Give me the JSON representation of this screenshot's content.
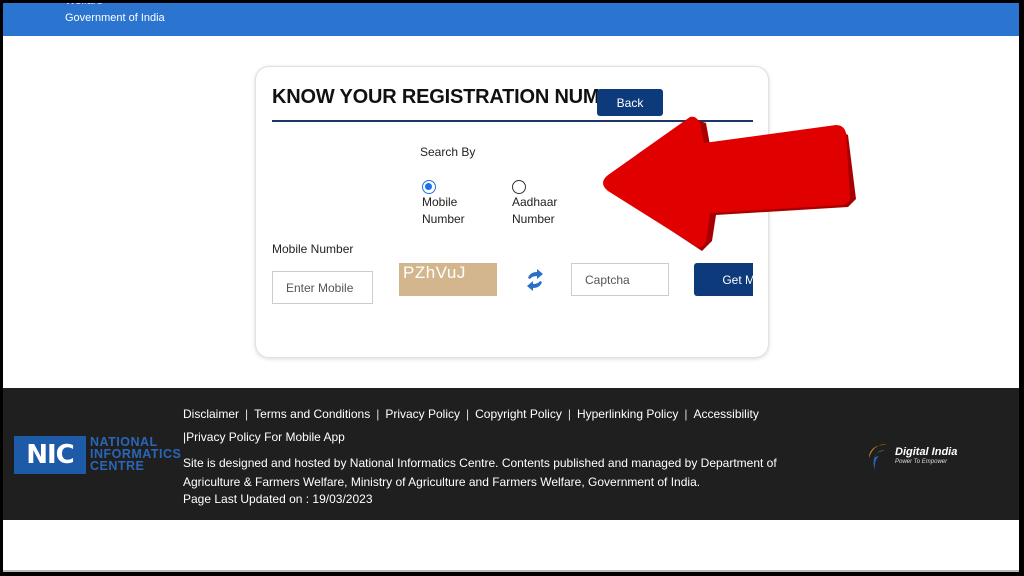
{
  "header": {
    "org_line1": "Welfare",
    "org_line2": "Government of India"
  },
  "form": {
    "title": "KNOW YOUR REGISTRATION NUMBER",
    "back_label": "Back",
    "search_by_label": "Search By",
    "options": [
      {
        "label": "Mobile Number",
        "selected": true
      },
      {
        "label": "Aadhaar Number",
        "selected": false
      }
    ],
    "mobile_label": "Mobile Number",
    "mobile_placeholder": "Enter Mobile",
    "captcha_text": "PZhVuJ",
    "captcha_placeholder": "Captcha",
    "get_button_label": "Get M"
  },
  "annotation": {
    "arrow_color": "#e00000",
    "arrow_direction": "left"
  },
  "footer": {
    "links": [
      "Disclaimer",
      "Terms and Conditions",
      "Privacy Policy",
      "Copyright Policy",
      "Hyperlinking Policy",
      "Accessibility"
    ],
    "links_line2": "Privacy Policy For Mobile App",
    "hosted_text": "Site is designed and hosted by National Informatics Centre. Contents published and managed by Department of Agriculture & Farmers Welfare, Ministry of Agriculture and Farmers Welfare, Government of India.",
    "last_updated": "Page Last Updated on : 19/03/2023",
    "nic_logo": {
      "abbr": "NIC",
      "line1": "NATIONAL",
      "line2": "INFORMATICS",
      "line3": "CENTRE"
    },
    "digital_india": {
      "title": "Digital India",
      "tagline": "Power To Empower"
    }
  },
  "colors": {
    "header_blue": "#2b74d0",
    "button_navy": "#0d3a7a",
    "footer_bg": "#1f1f1f",
    "captcha_bg": "#d3b68d"
  }
}
